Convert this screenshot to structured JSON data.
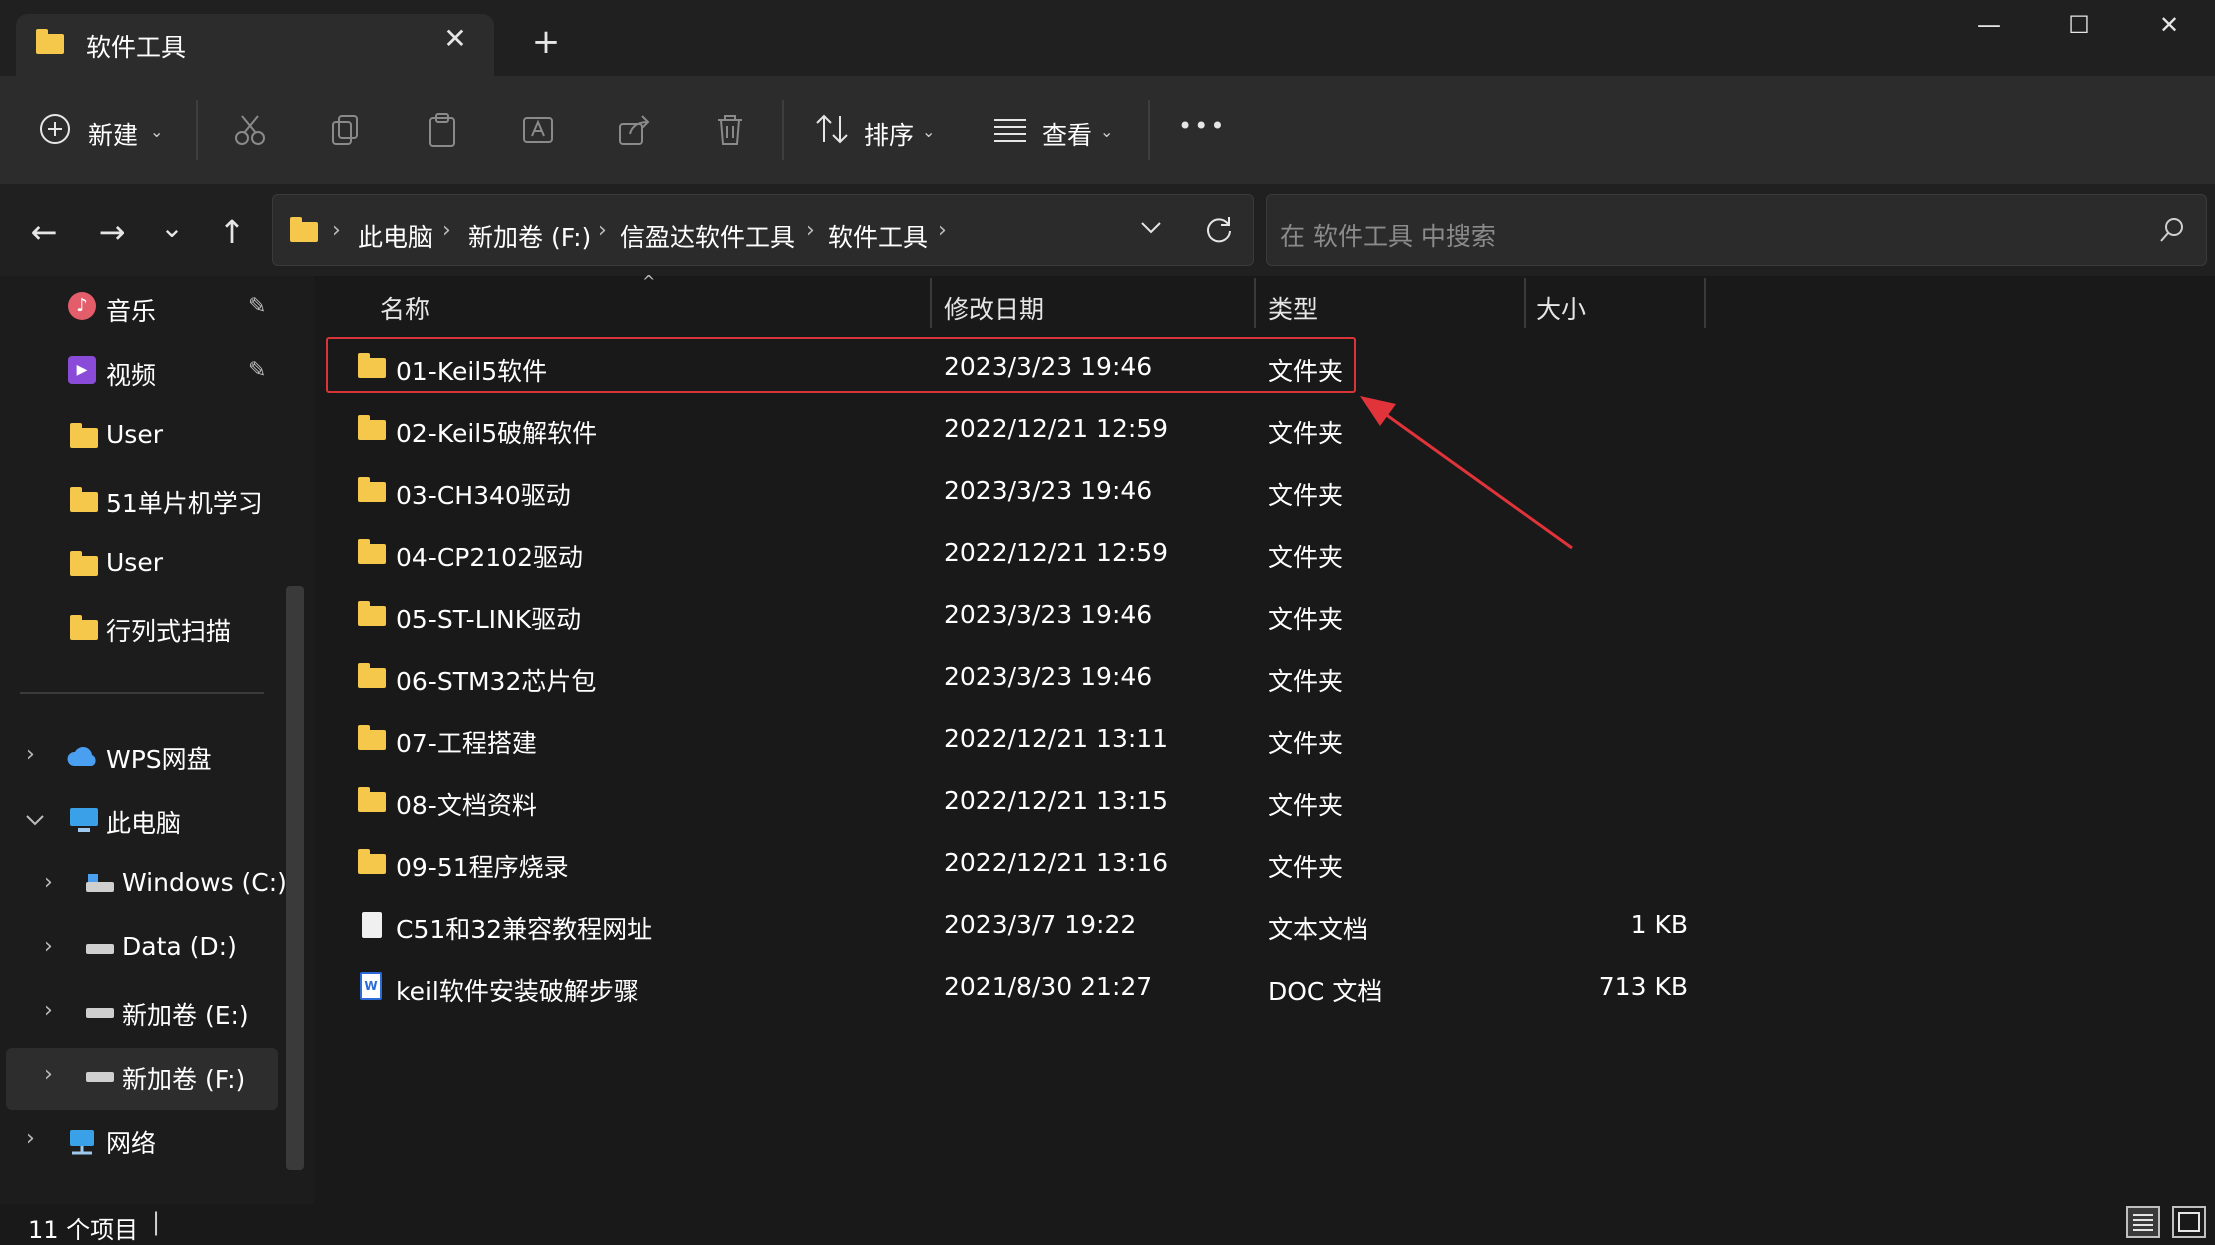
{
  "window": {
    "tab_title": "软件工具",
    "tab_close": "✕",
    "tab_add": "+",
    "minimize": "—",
    "maximize": "☐",
    "close": "✕"
  },
  "toolbar": {
    "new_label": "新建",
    "sort_label": "排序",
    "view_label": "查看",
    "more": "•••"
  },
  "nav": {
    "back": "←",
    "forward": "→",
    "recent": "⌄",
    "up": "↑",
    "breadcrumb": [
      "此电脑",
      "新加卷 (F:)",
      "信盈达软件工具",
      "软件工具"
    ],
    "search_placeholder": "在 软件工具 中搜索"
  },
  "sidebar": {
    "quick": [
      {
        "label": "音乐",
        "icon": "music-icon",
        "pinned": true
      },
      {
        "label": "视频",
        "icon": "video-icon",
        "pinned": true
      },
      {
        "label": "User",
        "icon": "folder-icon",
        "pinned": false
      },
      {
        "label": "51单片机学习",
        "icon": "folder-icon",
        "pinned": false
      },
      {
        "label": "User",
        "icon": "folder-icon",
        "pinned": false
      },
      {
        "label": "行列式扫描",
        "icon": "folder-icon",
        "pinned": false
      }
    ],
    "tree": [
      {
        "label": "WPS网盘",
        "icon": "cloud-icon",
        "level": 0,
        "expanded": false
      },
      {
        "label": "此电脑",
        "icon": "pc-icon",
        "level": 0,
        "expanded": true
      },
      {
        "label": "Windows (C:)",
        "icon": "drive-icon",
        "level": 1,
        "expanded": false
      },
      {
        "label": "Data (D:)",
        "icon": "drive-icon",
        "level": 1,
        "expanded": false
      },
      {
        "label": "新加卷 (E:)",
        "icon": "drive-icon",
        "level": 1,
        "expanded": false
      },
      {
        "label": "新加卷 (F:)",
        "icon": "drive-icon",
        "level": 1,
        "expanded": false,
        "selected": true
      },
      {
        "label": "网络",
        "icon": "network-icon",
        "level": 0,
        "expanded": false
      }
    ]
  },
  "columns": {
    "name": "名称",
    "modified": "修改日期",
    "type": "类型",
    "size": "大小"
  },
  "files": [
    {
      "name": "01-Keil5软件",
      "modified": "2023/3/23 19:46",
      "type": "文件夹",
      "size": "",
      "icon": "folder-icon"
    },
    {
      "name": "02-Keil5破解软件",
      "modified": "2022/12/21 12:59",
      "type": "文件夹",
      "size": "",
      "icon": "folder-icon"
    },
    {
      "name": "03-CH340驱动",
      "modified": "2023/3/23 19:46",
      "type": "文件夹",
      "size": "",
      "icon": "folder-icon"
    },
    {
      "name": "04-CP2102驱动",
      "modified": "2022/12/21 12:59",
      "type": "文件夹",
      "size": "",
      "icon": "folder-icon"
    },
    {
      "name": "05-ST-LINK驱动",
      "modified": "2023/3/23 19:46",
      "type": "文件夹",
      "size": "",
      "icon": "folder-icon"
    },
    {
      "name": "06-STM32芯片包",
      "modified": "2023/3/23 19:46",
      "type": "文件夹",
      "size": "",
      "icon": "folder-icon"
    },
    {
      "name": "07-工程搭建",
      "modified": "2022/12/21 13:11",
      "type": "文件夹",
      "size": "",
      "icon": "folder-icon"
    },
    {
      "name": "08-文档资料",
      "modified": "2022/12/21 13:15",
      "type": "文件夹",
      "size": "",
      "icon": "folder-icon"
    },
    {
      "name": "09-51程序烧录",
      "modified": "2022/12/21 13:16",
      "type": "文件夹",
      "size": "",
      "icon": "folder-icon"
    },
    {
      "name": "C51和32兼容教程网址",
      "modified": "2023/3/7 19:22",
      "type": "文本文档",
      "size": "1 KB",
      "icon": "text-file-icon"
    },
    {
      "name": "keil软件安装破解步骤",
      "modified": "2021/8/30 21:27",
      "type": "DOC 文档",
      "size": "713 KB",
      "icon": "word-doc-icon"
    }
  ],
  "status": {
    "item_count": "11 个项目"
  },
  "colors": {
    "highlight_box": "#d8353a",
    "arrow": "#e0343a",
    "folder": "#f5c84c"
  }
}
